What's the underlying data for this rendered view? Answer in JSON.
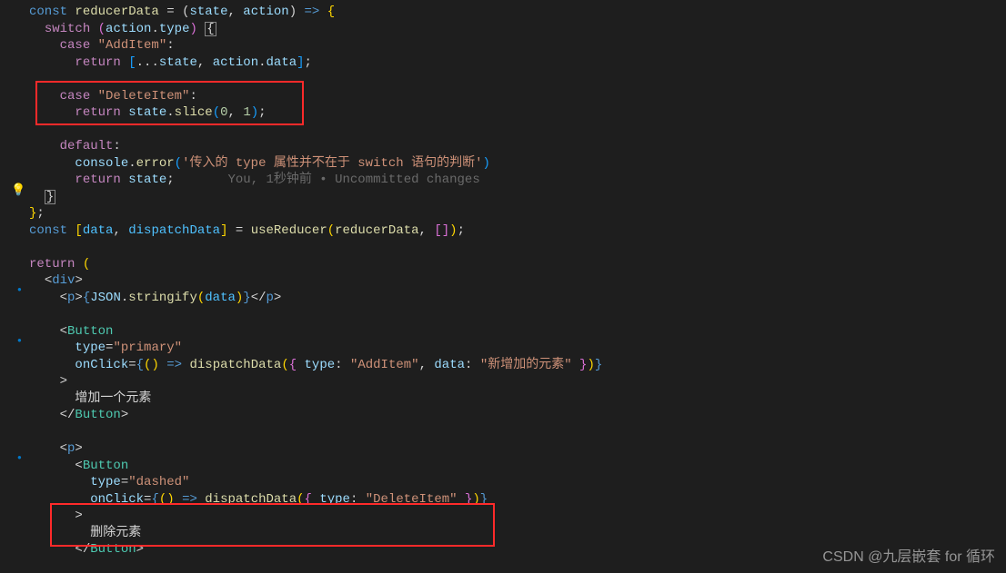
{
  "code": {
    "l1": "const reducerData = (state, action) => {",
    "l2": "  switch (action.type) {",
    "l3": "    case \"AddItem\":",
    "l4": "      return [...state, action.data];",
    "l5": "",
    "l6": "    case \"DeleteItem\":",
    "l7": "      return state.slice(0, 1);",
    "l8": "",
    "l9": "    default:",
    "l10": "      console.error('传入的 type 属性并不在于 switch 语句的判断')",
    "l11": "      return state;",
    "l11_hint": "You, 1秒钟前 • Uncommitted changes",
    "l12": "  }",
    "l13": "};",
    "l14": "const [data, dispatchData] = useReducer(reducerData, []);",
    "l15": "",
    "l16": "return (",
    "l17": "  <div>",
    "l18": "    <p>{JSON.stringify(data)}</p>",
    "l19": "",
    "l20": "    <Button",
    "l21": "      type=\"primary\"",
    "l22": "      onClick={() => dispatchData({ type: \"AddItem\", data: \"新增加的元素\" })}",
    "l23": "    >",
    "l24": "      增加一个元素",
    "l25": "    </Button>",
    "l26": "",
    "l27": "    <p>",
    "l28": "      <Button",
    "l29": "        type=\"dashed\"",
    "l30": "        onClick={() => dispatchData({ type: \"DeleteItem\" })}",
    "l31": "      >",
    "l32": "        删除元素",
    "l33": "      </Button>"
  },
  "watermark": "CSDN @九层嵌套 for 循环"
}
